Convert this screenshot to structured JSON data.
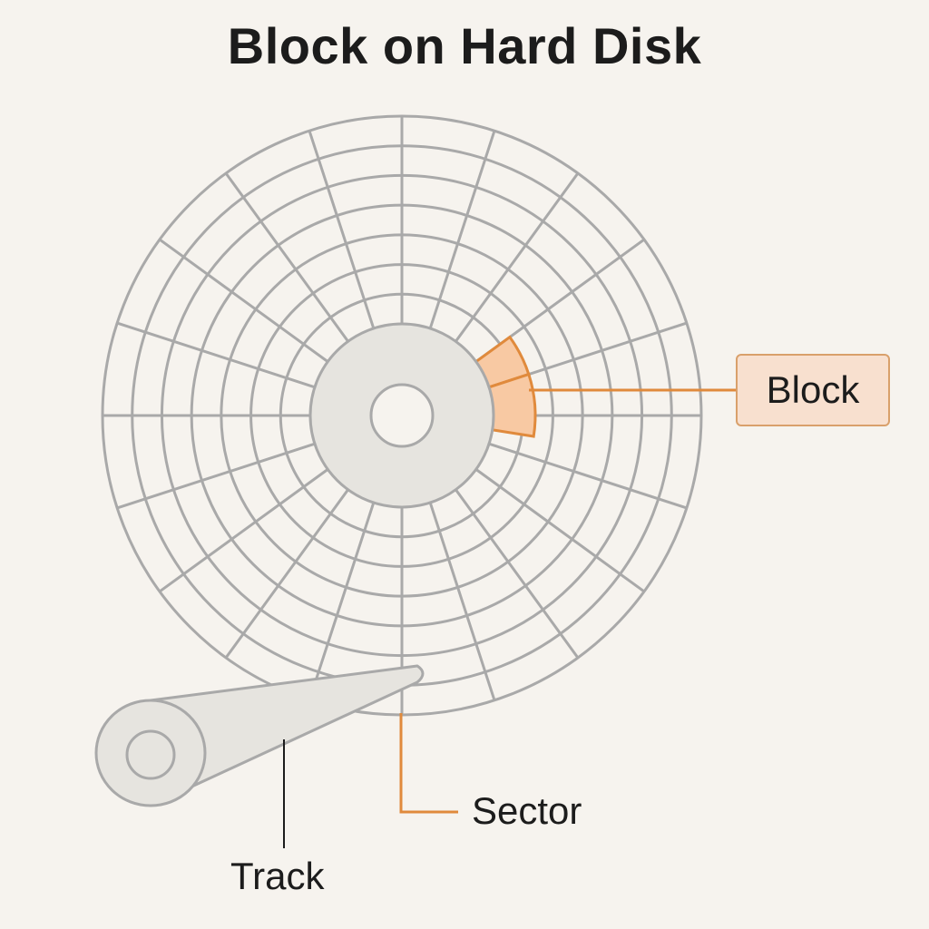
{
  "title": "Block on Hard Disk",
  "labels": {
    "block": "Block",
    "sector": "Sector",
    "track": "Track"
  },
  "disk": {
    "track_count": 7,
    "sector_count": 20
  },
  "colors": {
    "background": "#f6f3ee",
    "grid_line": "#a9a9a9",
    "hub_fill": "#e6e4df",
    "highlight_fill": "#f8c9a3",
    "highlight_stroke": "#e08a3c",
    "leader_line": "#e08a3c",
    "track_leader": "#1c1c1c"
  }
}
